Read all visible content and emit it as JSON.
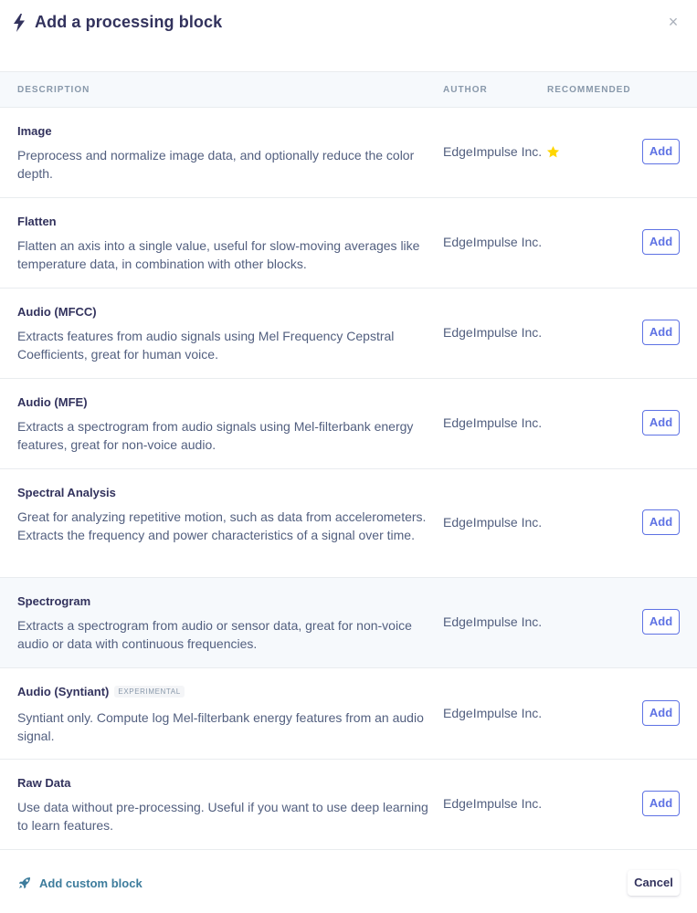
{
  "modal": {
    "title": "Add a processing block",
    "close_glyph": "×",
    "icons": {
      "title": "bolt-icon",
      "close": "close-icon",
      "recommended": "star-icon",
      "custom": "rocket-icon"
    }
  },
  "table": {
    "columns": {
      "description": "DESCRIPTION",
      "author": "AUTHOR",
      "recommended": "RECOMMENDED"
    },
    "rows": [
      {
        "name": "Image",
        "description": "Preprocess and normalize image data, and optionally reduce the color depth.",
        "author": "EdgeImpulse Inc.",
        "recommended": true,
        "action": "Add"
      },
      {
        "name": "Flatten",
        "description": "Flatten an axis into a single value, useful for slow-moving averages like temperature data, in combination with other blocks.",
        "author": "EdgeImpulse Inc.",
        "recommended": false,
        "action": "Add"
      },
      {
        "name": "Audio (MFCC)",
        "description": "Extracts features from audio signals using Mel Frequency Cepstral Coefficients, great for human voice.",
        "author": "EdgeImpulse Inc.",
        "recommended": false,
        "action": "Add"
      },
      {
        "name": "Audio (MFE)",
        "description": "Extracts a spectrogram from audio signals using Mel-filterbank energy features, great for non-voice audio.",
        "author": "EdgeImpulse Inc.",
        "recommended": false,
        "action": "Add"
      },
      {
        "name": "Spectral Analysis",
        "description": "Great for analyzing repetitive motion, such as data from accelerometers. Extracts the frequency and power characteristics of a signal over time.",
        "author": "EdgeImpulse Inc.",
        "recommended": false,
        "action": "Add"
      },
      {
        "name": "Spectrogram",
        "description": "Extracts a spectrogram from audio or sensor data, great for non-voice audio or data with continuous frequencies.",
        "author": "EdgeImpulse Inc.",
        "recommended": false,
        "action": "Add",
        "highlighted": true
      },
      {
        "name": "Audio (Syntiant)",
        "badge": "EXPERIMENTAL",
        "description": "Syntiant only. Compute log Mel-filterbank energy features from an audio signal.",
        "author": "EdgeImpulse Inc.",
        "recommended": false,
        "action": "Add"
      },
      {
        "name": "Raw Data",
        "description": "Use data without pre-processing. Useful if you want to use deep learning to learn features.",
        "author": "EdgeImpulse Inc.",
        "recommended": false,
        "action": "Add"
      }
    ]
  },
  "footer": {
    "custom_label": "Add custom block",
    "cancel_label": "Cancel"
  },
  "colors": {
    "accent": "#5e72e4",
    "title": "#32325d",
    "text": "#525f7f",
    "muted": "#8898aa",
    "star": "#ffd600",
    "link": "#3d7c9c"
  }
}
